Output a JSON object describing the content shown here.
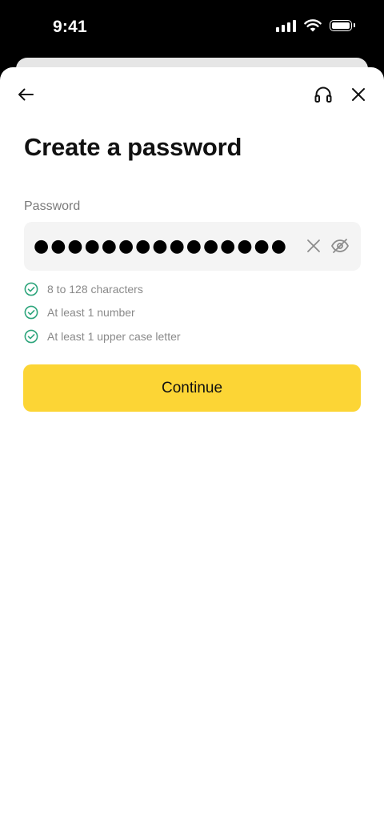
{
  "status_bar": {
    "time": "9:41"
  },
  "header": {
    "back_icon": "arrow-left-icon",
    "support_icon": "headset-icon",
    "close_icon": "close-icon"
  },
  "page": {
    "title": "Create a password"
  },
  "password_field": {
    "label": "Password",
    "value": "●●●●●●●●●●●●●●●",
    "clear_icon": "clear-icon",
    "visibility_icon": "eye-off-icon"
  },
  "rules": [
    {
      "label": "8 to 128 characters",
      "met": true
    },
    {
      "label": "At least 1 number",
      "met": true
    },
    {
      "label": "At least 1 upper case letter",
      "met": true
    }
  ],
  "continue_button": {
    "label": "Continue"
  },
  "colors": {
    "accent": "#FCD535",
    "check": "#2EA57C",
    "field_bg": "#F4F4F4",
    "muted_text": "#8A8A8A"
  }
}
